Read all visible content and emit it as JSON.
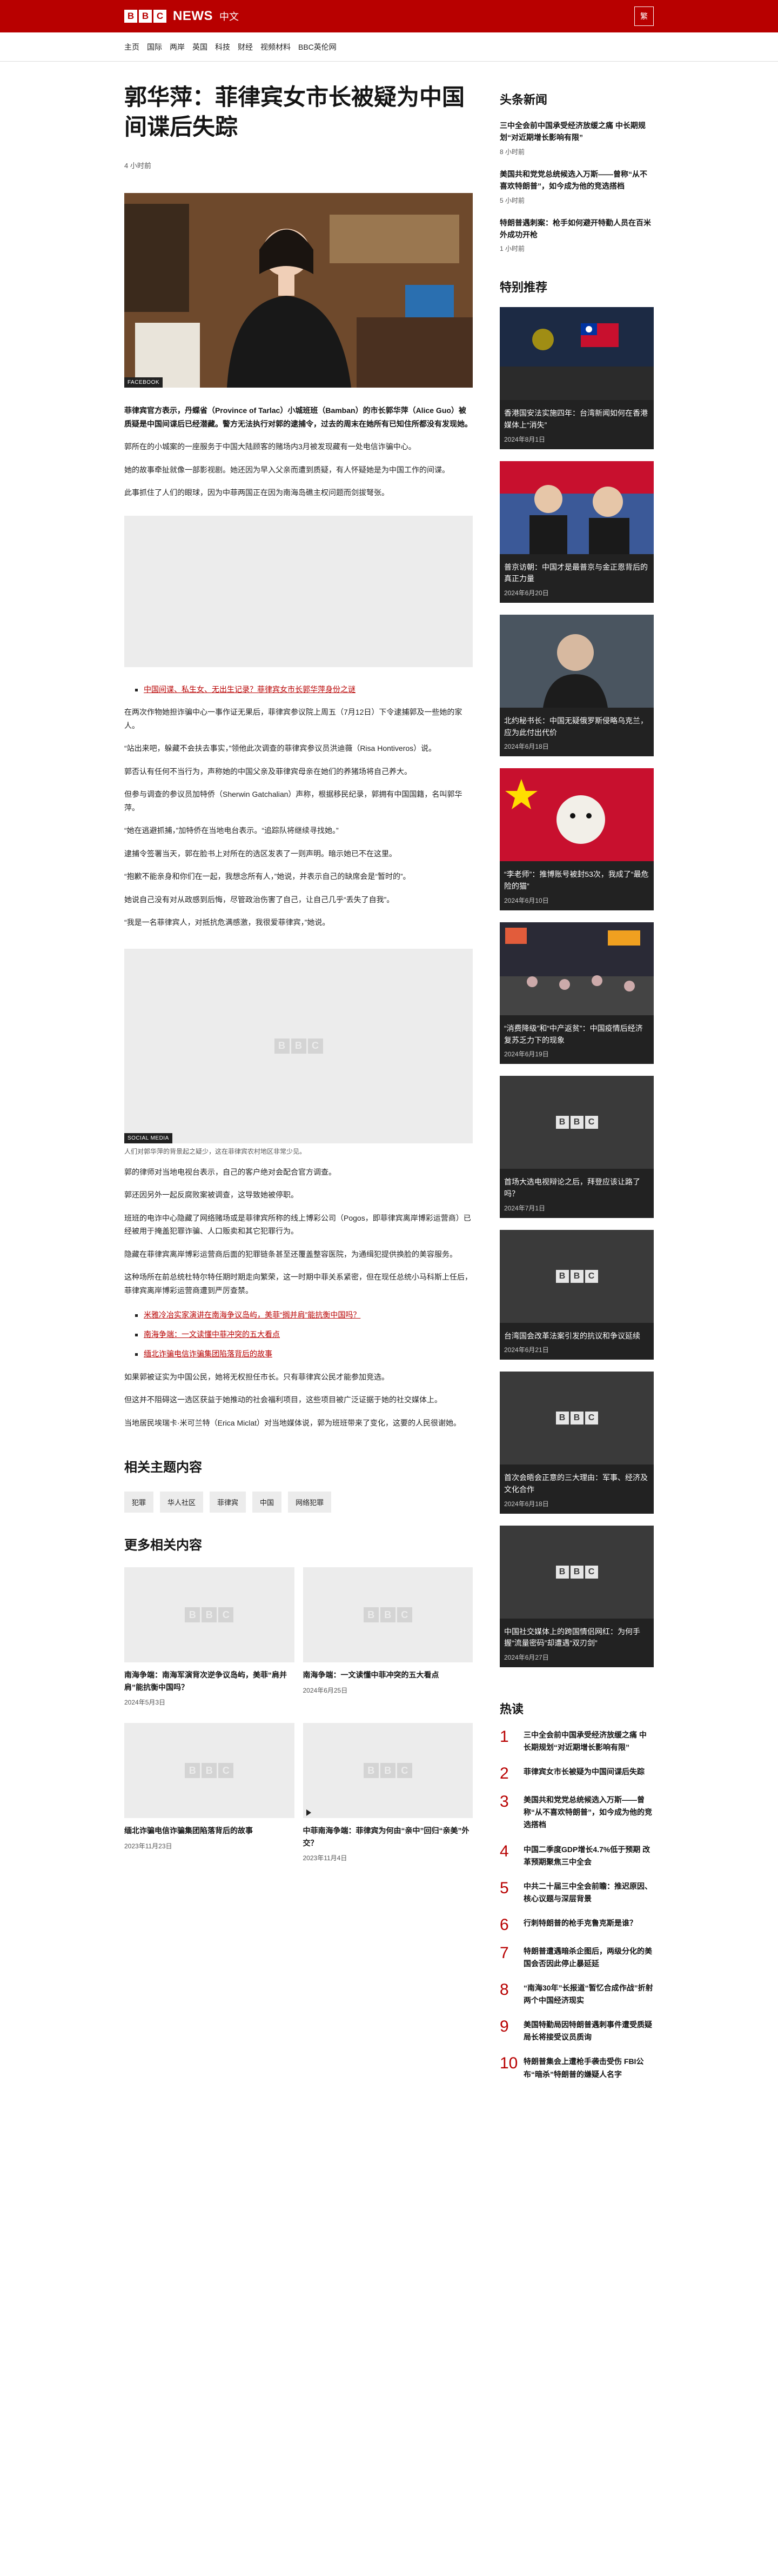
{
  "masthead": {
    "logo_letters": [
      "B",
      "B",
      "C"
    ],
    "news": "NEWS",
    "zh": "中文",
    "lang_toggle": "繁"
  },
  "nav": [
    "主页",
    "国际",
    "两岸",
    "英国",
    "科技",
    "财经",
    "视频材料",
    "BBC英伦网"
  ],
  "article": {
    "headline": "郭华萍：菲律宾女市长被疑为中国间谍后失踪",
    "timestamp": "4 小时前",
    "hero_tag": "FACEBOOK",
    "lead": "菲律宾官方表示，丹蝶省（Province of Tarlac）小城班班（Bamban）的市长郭华萍（Alice Guo）被质疑是中国间谍后已经潜藏。警方无法执行对郭的逮捕令，过去的周末在她所有已知住所都没有发现她。",
    "paras_a": [
      "郭所在的小城案的一座服务于中国大陆顾客的赌场内3月被发现藏有一处电信诈骗中心。",
      "她的故事牵扯就像一部影视剧。她还因为早入父亲而遭到质疑，有人怀疑她是为中国工作的间谍。",
      "此事抓住了人们的眼球，因为中菲两国正在因为南海岛礁主权问题而剑拔弩张。"
    ],
    "related_link": "中国间谍、私生女、无出生记录？菲律宾女市长郭华萍身份之谜",
    "paras_b": [
      "在两次作物她担诈骗中心一事作证无果后，菲律宾参议院上周五（7月12日）下令逮捕郭及一些她的家人。",
      "“站出来吧，躲藏不会扶去事实，”领他此次调查的菲律宾参议员洪迪薇（Risa Hontiveros）说。",
      "郭否认有任何不当行为，声称她的中国父亲及菲律宾母亲在她们的养猪场将自己养大。",
      "但参与调查的参议员加特侨（Sherwin Gatchalian）声称，根据移民纪录，郭拥有中国国籍，名叫郭华萍。",
      "“她在逃避抓捕，”加特侨在当地电台表示。“追踪队将继续寻找她。”",
      "逮捕令签署当天，郭在脸书上对所在的选区发表了一则声明。暗示她已不在这里。",
      "“抱歉不能亲身和你们在一起，我想念所有人，”她说，并表示自己的缺席会是“暂时的”。",
      "她说自己没有对从政感到后悔，尽管政治伤害了自己，让自己几乎“丢失了自我”。",
      "“我是一名菲律宾人，对抵抗危满感激，我很爱菲律宾，”她说。"
    ],
    "media_tag": "SOCIAL MEDIA",
    "media_caption": "人们对郭华萍的背景起之疑少，这在菲律宾农村地区非常少见。",
    "paras_c": [
      "郭的律师对当地电视台表示，自己的客户绝对会配合官方调查。",
      "郭还因另外一起反腐败案被调查，这导致她被停职。",
      "班班的电诈中心隐藏了网络赌场或是菲律宾所称的线上博彩公司（Pogos，即菲律宾离岸博彩运营商）已经被用于掩盖犯罪诈骗、人口贩卖和其它犯罪行为。",
      "隐藏在菲律宾离岸博彩运营商后面的犯罪链条甚至还覆盖整容医院，为通缉犯提供换脸的美容服务。",
      "这种场所在前总统杜特尔特任期时期走向繁荣，这一时期中菲关系紧密，但在现任总统小马科斯上任后，菲律宾离岸博彩运营商遭到严厉查禁。"
    ],
    "links2": [
      "米雅冷冶实家演讲在南海争议岛屿，美菲“搁并肩”能抗衡中国吗？",
      "南海争端：一文读懂中菲冲突的五大看点",
      "缅北诈骗电信诈骗集团陷落背后的故事"
    ],
    "paras_d": [
      "如果郭被证实为中国公民，她将无权担任市长。只有菲律宾公民才能参加竞选。",
      "但这并不阻碍这一选区获益于她推动的社会福利项目，这些项目被广泛证据于她的社交媒体上。",
      "当地居民埃瑞卡·米可兰特（Erica Miclat）对当地媒体说，郭为班班带来了变化，这要的人民很谢她。"
    ]
  },
  "related_topics": {
    "title": "相关主题内容",
    "items": [
      "犯罪",
      "华人社区",
      "菲律宾",
      "中国",
      "网络犯罪"
    ]
  },
  "more": {
    "title": "更多相关内容",
    "cards": [
      {
        "title": "南海争端：南海军演背次逆争议岛屿，美菲“肩并肩”能抗衡中国吗？",
        "date": "2024年5月3日"
      },
      {
        "title": "南海争端：一文读懂中菲冲突的五大看点",
        "date": "2024年6月25日"
      },
      {
        "title": "缅北诈骗电信诈骗集团陷落背后的故事",
        "date": "2023年11月23日"
      },
      {
        "title": "中菲南海争端：菲律宾为何由“亲中”回归“亲美”外交？",
        "date": "2023年11月4日"
      }
    ]
  },
  "sidebar": {
    "headlines_title": "头条新闻",
    "headlines": [
      {
        "title": "三中全会前中国承受经济放缓之痛 中长期规划“对近期增长影响有限”",
        "date": "8 小时前"
      },
      {
        "title": "美国共和党党总统候选入万斯——曾称“从不喜欢特朗普”，如今成为他的竞选搭档",
        "date": "5 小时前"
      },
      {
        "title": "特朗普遇刺案：枪手如何避开特勤人员在百米外成功开枪",
        "date": "1 小时前"
      }
    ],
    "featured_title": "特别推荐",
    "featured": [
      {
        "title": "香港国安法实施四年：台湾新闻如何在香港媒体上“消失”",
        "date": "2024年8月1日"
      },
      {
        "title": "普京访朝：中国才是最普京与金正恩背后的真正力量",
        "date": "2024年6月20日"
      },
      {
        "title": "北约秘书长：中国无疑俄罗斯侵略乌克兰，应为此付出代价",
        "date": "2024年6月18日"
      },
      {
        "title": "“李老师”：推博账号被封53次，我成了“最危险的猫”",
        "date": "2024年6月10日"
      },
      {
        "title": "“消费降级”和“中产返贫”：中国疫情后经济复苏乏力下的现象",
        "date": "2024年6月19日"
      },
      {
        "title": "首场大选电视辩论之后，拜登应该让路了吗？",
        "date": "2024年7月1日"
      },
      {
        "title": "台湾国会改革法案引发的抗议和争议延续",
        "date": "2024年6月21日"
      },
      {
        "title": "首次会晤会正意的三大理由：军事、经济及文化合作",
        "date": "2024年6月18日"
      },
      {
        "title": "中国社交媒体上的跨国情侣网红：为何手握“流量密码”却遭遇“双刃剑”",
        "date": "2024年6月27日"
      }
    ],
    "popular_title": "热读",
    "popular": [
      "三中全会前中国承受经济放缓之痛 中长期规划“对近期增长影响有限”",
      "菲律宾女市长被疑为中国间谍后失踪",
      "美国共和党党总统候选入万斯——曾称“从不喜欢特朗普”，如今成为他的竞选搭档",
      "中国二季度GDP增长4.7%低于预期 改革预期聚焦三中全会",
      "中共二十届三中全会前瞻：推迟原因、核心议题与深层背景",
      "行刺特朗普的枪手克鲁克斯是谁？",
      "特朗普遭遇暗杀企图后，两级分化的美国会否因此停止暴延延",
      "“南海30年”长报道“暂忆合成作战”折射两个中国经济现实",
      "美国特勤局因特朗普遇刺事件遭受质疑 局长将接受议员质询",
      "特朗普集会上遭枪手袭击受伤 FBI公布“暗杀”特朗普的嫌疑人名字"
    ]
  },
  "colors": {
    "brand": "#b80000"
  }
}
